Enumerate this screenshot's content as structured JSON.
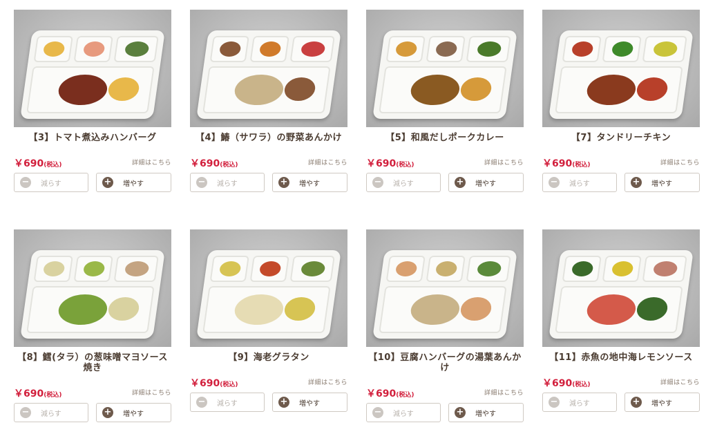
{
  "labels": {
    "detail": "詳細はこちら",
    "minus": "減らす",
    "plus": "増やす",
    "tax": "(税込)"
  },
  "items": [
    {
      "title": "【3】トマト煮込みハンバーグ",
      "price": "￥690",
      "colors": [
        "#e8b84a",
        "#e79a7e",
        "#5a7f3d",
        "#7a2e1e"
      ]
    },
    {
      "title": "【4】鰆（サワラ）の野菜あんかけ",
      "price": "￥690",
      "colors": [
        "#8a5a3a",
        "#d07a2a",
        "#c94040",
        "#c9b48a"
      ]
    },
    {
      "title": "【5】和風だしポークカレー",
      "price": "￥690",
      "colors": [
        "#d69a3a",
        "#8a6a52",
        "#4a7a2a",
        "#8a5a22"
      ]
    },
    {
      "title": "【7】タンドリーチキン",
      "price": "￥690",
      "colors": [
        "#b8402a",
        "#3e8a2a",
        "#c9c43a",
        "#8a3a1e"
      ]
    },
    {
      "title": "【8】鱈(タラ）の葱味噌マヨソース焼き",
      "price": "￥690",
      "colors": [
        "#d9d2a0",
        "#9ab848",
        "#c4a482",
        "#7aa23a"
      ]
    },
    {
      "title": "【9】海老グラタン",
      "price": "￥690",
      "colors": [
        "#d7c454",
        "#c44a2a",
        "#6a8a3a",
        "#e6dcb4"
      ]
    },
    {
      "title": "【10】豆腐ハンバーグの湯葉あんかけ",
      "price": "￥690",
      "colors": [
        "#d9a070",
        "#c9b070",
        "#5a8a3a",
        "#c9b48a"
      ]
    },
    {
      "title": "【11】赤魚の地中海レモンソース",
      "price": "￥690",
      "colors": [
        "#3a6a2a",
        "#d9c030",
        "#c08070",
        "#d45a4a"
      ]
    }
  ]
}
